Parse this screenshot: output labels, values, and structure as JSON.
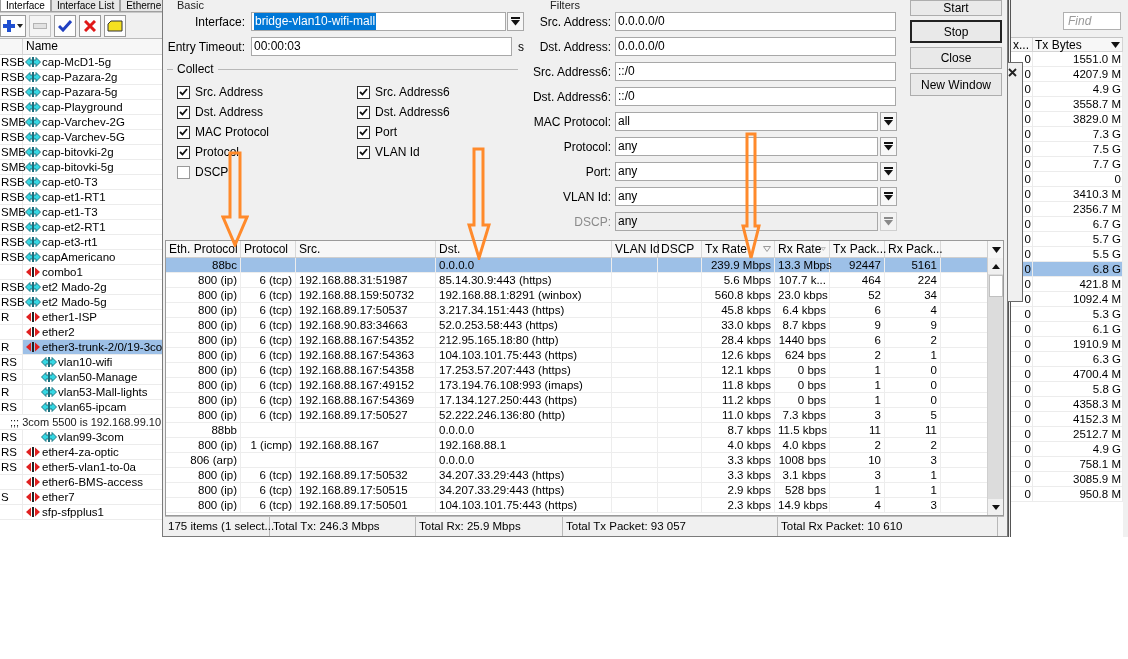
{
  "interfaces": {
    "tabs": [
      {
        "label": "Interface",
        "selected": true
      },
      {
        "label": "Interface List",
        "selected": false
      },
      {
        "label": "Etherne",
        "selected": false
      }
    ],
    "toolbar": [
      {
        "kind": "add",
        "disabled": false
      },
      {
        "kind": "remove",
        "disabled": true
      },
      {
        "kind": "enable",
        "disabled": false
      },
      {
        "kind": "disable",
        "disabled": false
      },
      {
        "kind": "comment",
        "disabled": false
      }
    ],
    "name_header": "Name",
    "rows": [
      {
        "flags": "RSB",
        "name": "cap-McD1-5g",
        "kind": "wireless",
        "selected": false
      },
      {
        "flags": "RSB",
        "name": "cap-Pazara-2g",
        "kind": "wireless",
        "selected": false
      },
      {
        "flags": "RSB",
        "name": "cap-Pazara-5g",
        "kind": "wireless",
        "selected": false
      },
      {
        "flags": "RSB",
        "name": "cap-Playground",
        "kind": "wireless",
        "selected": false
      },
      {
        "flags": "SMB",
        "name": "cap-Varchev-2G",
        "kind": "wireless",
        "selected": false
      },
      {
        "flags": "RSB",
        "name": "cap-Varchev-5G",
        "kind": "wireless",
        "selected": false
      },
      {
        "flags": "SMB",
        "name": "cap-bitovki-2g",
        "kind": "wireless",
        "selected": false
      },
      {
        "flags": "SMB",
        "name": "cap-bitovki-5g",
        "kind": "wireless",
        "selected": false
      },
      {
        "flags": "RSB",
        "name": "cap-et0-T3",
        "kind": "wireless",
        "selected": false
      },
      {
        "flags": "RSB",
        "name": "cap-et1-RT1",
        "kind": "wireless",
        "selected": false
      },
      {
        "flags": "SMB",
        "name": "cap-et1-T3",
        "kind": "wireless",
        "selected": false
      },
      {
        "flags": "RSB",
        "name": "cap-et2-RT1",
        "kind": "wireless",
        "selected": false
      },
      {
        "flags": "RSB",
        "name": "cap-et3-rt1",
        "kind": "wireless",
        "selected": false
      },
      {
        "flags": "RSB",
        "name": "capAmericano",
        "kind": "wireless",
        "selected": false
      },
      {
        "name": "combo1",
        "kind": "ethernet",
        "selected": false
      },
      {
        "flags": "RSB",
        "name": "et2 Mado-2g",
        "kind": "wireless",
        "selected": false
      },
      {
        "flags": "RSB",
        "name": "et2 Mado-5g",
        "kind": "wireless",
        "selected": false
      },
      {
        "flags": "R",
        "name": "ether1-ISP",
        "kind": "ethernet",
        "selected": false
      },
      {
        "name": "ether2",
        "kind": "ethernet",
        "selected": false
      },
      {
        "flags": "R",
        "name": "ether3-trunk-2/0/19-3co",
        "kind": "ethernet",
        "selected": true,
        "children": [
          {
            "flags": "RS",
            "name": "vlan10-wifi",
            "kind": "vlan",
            "selected": false
          },
          {
            "flags": "RS",
            "name": "vlan50-Manage",
            "kind": "vlan",
            "selected": false
          },
          {
            "flags": "R",
            "name": "vlan53-Mall-lights",
            "kind": "vlan",
            "selected": false
          },
          {
            "flags": "RS",
            "name": "vlan65-ipcam",
            "kind": "vlan",
            "selected": false
          },
          {
            "flags": "RS",
            "comment": ";;; 3com 5500 is 192.168.99.10",
            "name": "vlan99-3com",
            "kind": "vlan",
            "selected": false
          }
        ]
      },
      {
        "flags": "RS",
        "name": "ether4-za-optic",
        "kind": "ethernet",
        "selected": false
      },
      {
        "flags": "RS",
        "name": "ether5-vlan1-to-0a",
        "kind": "ethernet",
        "selected": false
      },
      {
        "name": "ether6-BMS-access",
        "kind": "ethernet",
        "selected": false
      },
      {
        "flags": "S",
        "name": "ether7",
        "kind": "ethernet",
        "selected": false
      },
      {
        "name": "sfp-sfpplus1",
        "kind": "ethernet",
        "selected": false
      }
    ]
  },
  "torch": {
    "basic": {
      "title": "Basic",
      "interface_label": "Interface:",
      "interface": "bridge-vlan10-wifi-mall",
      "interface_text_selected": true,
      "timeout_label": "Entry Timeout:",
      "entry_timeout": "00:00:03",
      "timeout_unit": "s"
    },
    "collect": {
      "title": "Collect",
      "options": [
        {
          "label": "Src. Address",
          "checked": true
        },
        {
          "label": "Dst. Address",
          "checked": true
        },
        {
          "label": "MAC Protocol",
          "checked": true
        },
        {
          "label": "Protocol",
          "checked": true
        },
        {
          "label": "DSCP",
          "checked": false
        },
        {
          "label": "Src. Address6",
          "checked": true
        },
        {
          "label": "Dst. Address6",
          "checked": true
        },
        {
          "label": "Port",
          "checked": true
        },
        {
          "label": "VLAN Id",
          "checked": true
        }
      ]
    },
    "filters": {
      "title": "Filters",
      "fields": [
        {
          "label": "Src. Address:",
          "value": "0.0.0.0/0",
          "kind": "text",
          "disabled": false
        },
        {
          "label": "Dst. Address:",
          "value": "0.0.0.0/0",
          "kind": "text",
          "disabled": false
        },
        {
          "label": "Src. Address6:",
          "value": "::/0",
          "kind": "text",
          "disabled": false
        },
        {
          "label": "Dst. Address6:",
          "value": "::/0",
          "kind": "text",
          "disabled": false
        },
        {
          "label": "MAC Protocol:",
          "value": "all",
          "kind": "select",
          "disabled": false
        },
        {
          "label": "Protocol:",
          "value": "any",
          "kind": "select",
          "disabled": false
        },
        {
          "label": "Port:",
          "value": "any",
          "kind": "select",
          "disabled": false
        },
        {
          "label": "VLAN Id:",
          "value": "any",
          "kind": "select",
          "disabled": false
        },
        {
          "label": "DSCP:",
          "value": "any",
          "kind": "select",
          "disabled": true
        }
      ]
    },
    "buttons": [
      {
        "label": "Start",
        "default": false
      },
      {
        "label": "Stop",
        "default": true
      },
      {
        "label": "Close",
        "default": false
      },
      {
        "label": "New Window",
        "default": false
      }
    ],
    "table": {
      "columns": [
        {
          "label": "Eth. Protocol"
        },
        {
          "label": "Protocol"
        },
        {
          "label": "Src."
        },
        {
          "label": "Dst."
        },
        {
          "label": "VLAN Id"
        },
        {
          "label": "DSCP"
        },
        {
          "label": "Tx Rate",
          "sort_indicator": true
        },
        {
          "label": "Rx Rate",
          "sort_indicator": true
        },
        {
          "label": "Tx Pack..."
        },
        {
          "label": "Rx Pack..."
        }
      ],
      "rows": [
        {
          "eth_protocol": "88bc",
          "dst": "0.0.0.0",
          "tx_rate": "239.9 Mbps",
          "rx_rate": "13.3 Mbps",
          "tx_packets": "92447",
          "rx_packets": "5161",
          "selected": true
        },
        {
          "eth_protocol": "800 (ip)",
          "protocol": "6 (tcp)",
          "src": "192.168.88.31:51987",
          "dst": "85.14.30.9:443 (https)",
          "tx_rate": "5.6 Mbps",
          "rx_rate": "107.7 k...",
          "tx_packets": "464",
          "rx_packets": "224",
          "selected": false
        },
        {
          "eth_protocol": "800 (ip)",
          "protocol": "6 (tcp)",
          "src": "192.168.88.159:50732",
          "dst": "192.168.88.1:8291 (winbox)",
          "tx_rate": "560.8 kbps",
          "rx_rate": "23.0 kbps",
          "tx_packets": "52",
          "rx_packets": "34",
          "selected": false
        },
        {
          "eth_protocol": "800 (ip)",
          "protocol": "6 (tcp)",
          "src": "192.168.89.17:50537",
          "dst": "3.217.34.151:443 (https)",
          "tx_rate": "45.8 kbps",
          "rx_rate": "6.4 kbps",
          "tx_packets": "6",
          "rx_packets": "4",
          "selected": false
        },
        {
          "eth_protocol": "800 (ip)",
          "protocol": "6 (tcp)",
          "src": "192.168.90.83:34663",
          "dst": "52.0.253.58:443 (https)",
          "tx_rate": "33.0 kbps",
          "rx_rate": "8.7 kbps",
          "tx_packets": "9",
          "rx_packets": "9",
          "selected": false
        },
        {
          "eth_protocol": "800 (ip)",
          "protocol": "6 (tcp)",
          "src": "192.168.88.167:54352",
          "dst": "212.95.165.18:80 (http)",
          "tx_rate": "28.4 kbps",
          "rx_rate": "1440 bps",
          "tx_packets": "6",
          "rx_packets": "2",
          "selected": false
        },
        {
          "eth_protocol": "800 (ip)",
          "protocol": "6 (tcp)",
          "src": "192.168.88.167:54363",
          "dst": "104.103.101.75:443 (https)",
          "tx_rate": "12.6 kbps",
          "rx_rate": "624 bps",
          "tx_packets": "2",
          "rx_packets": "1",
          "selected": false
        },
        {
          "eth_protocol": "800 (ip)",
          "protocol": "6 (tcp)",
          "src": "192.168.88.167:54358",
          "dst": "17.253.57.207:443 (https)",
          "tx_rate": "12.1 kbps",
          "rx_rate": "0 bps",
          "tx_packets": "1",
          "rx_packets": "0",
          "selected": false
        },
        {
          "eth_protocol": "800 (ip)",
          "protocol": "6 (tcp)",
          "src": "192.168.88.167:49152",
          "dst": "173.194.76.108:993 (imaps)",
          "tx_rate": "11.8 kbps",
          "rx_rate": "0 bps",
          "tx_packets": "1",
          "rx_packets": "0",
          "selected": false
        },
        {
          "eth_protocol": "800 (ip)",
          "protocol": "6 (tcp)",
          "src": "192.168.88.167:54369",
          "dst": "17.134.127.250:443 (https)",
          "tx_rate": "11.2 kbps",
          "rx_rate": "0 bps",
          "tx_packets": "1",
          "rx_packets": "0",
          "selected": false
        },
        {
          "eth_protocol": "800 (ip)",
          "protocol": "6 (tcp)",
          "src": "192.168.89.17:50527",
          "dst": "52.222.246.136:80 (http)",
          "tx_rate": "11.0 kbps",
          "rx_rate": "7.3 kbps",
          "tx_packets": "3",
          "rx_packets": "5",
          "selected": false
        },
        {
          "eth_protocol": "88bb",
          "dst": "0.0.0.0",
          "tx_rate": "8.7 kbps",
          "rx_rate": "11.5 kbps",
          "tx_packets": "11",
          "rx_packets": "11",
          "selected": false
        },
        {
          "eth_protocol": "800 (ip)",
          "protocol": "1 (icmp)",
          "src": "192.168.88.167",
          "dst": "192.168.88.1",
          "tx_rate": "4.0 kbps",
          "rx_rate": "4.0 kbps",
          "tx_packets": "2",
          "rx_packets": "2",
          "selected": false
        },
        {
          "eth_protocol": "806 (arp)",
          "dst": "0.0.0.0",
          "tx_rate": "3.3 kbps",
          "rx_rate": "1008 bps",
          "tx_packets": "10",
          "rx_packets": "3",
          "selected": false
        },
        {
          "eth_protocol": "800 (ip)",
          "protocol": "6 (tcp)",
          "src": "192.168.89.17:50532",
          "dst": "34.207.33.29:443 (https)",
          "tx_rate": "3.3 kbps",
          "rx_rate": "3.1 kbps",
          "tx_packets": "3",
          "rx_packets": "1",
          "selected": false
        },
        {
          "eth_protocol": "800 (ip)",
          "protocol": "6 (tcp)",
          "src": "192.168.89.17:50515",
          "dst": "34.207.33.29:443 (https)",
          "tx_rate": "2.9 kbps",
          "rx_rate": "528 bps",
          "tx_packets": "1",
          "rx_packets": "1",
          "selected": false
        },
        {
          "eth_protocol": "800 (ip)",
          "protocol": "6 (tcp)",
          "src": "192.168.89.17:50501",
          "dst": "104.103.101.75:443 (https)",
          "tx_rate": "2.3 kbps",
          "rx_rate": "14.9 kbps",
          "tx_packets": "4",
          "rx_packets": "3",
          "selected": false
        }
      ]
    },
    "status_bar": [
      "175 items (1 select...",
      "Total Tx: 246.3 Mbps",
      "Total Rx: 25.9 Mbps",
      "Total Tx Packet: 93 057",
      "Total Rx Packet: 10 610"
    ]
  },
  "traffic_list": {
    "find": {
      "placeholder": "Find"
    },
    "columns": [
      "x...",
      "Tx Bytes"
    ],
    "rows": [
      {
        "rx": "0",
        "tx_bytes": "1551.0 M",
        "selected": false
      },
      {
        "rx": "0",
        "tx_bytes": "4207.9 M",
        "selected": false
      },
      {
        "rx": "0",
        "tx_bytes": "4.9 G",
        "selected": false
      },
      {
        "rx": "0",
        "tx_bytes": "3558.7 M",
        "selected": false
      },
      {
        "rx": "0",
        "tx_bytes": "3829.0 M",
        "selected": false
      },
      {
        "rx": "0",
        "tx_bytes": "7.3 G",
        "selected": false
      },
      {
        "rx": "0",
        "tx_bytes": "7.5 G",
        "selected": false
      },
      {
        "rx": "0",
        "tx_bytes": "7.7 G",
        "selected": false
      },
      {
        "rx": "0",
        "tx_bytes": "0",
        "selected": false
      },
      {
        "rx": "0",
        "tx_bytes": "3410.3 M",
        "selected": false
      },
      {
        "rx": "0",
        "tx_bytes": "2356.7 M",
        "selected": false
      },
      {
        "rx": "0",
        "tx_bytes": "6.7 G",
        "selected": false
      },
      {
        "rx": "0",
        "tx_bytes": "5.7 G",
        "selected": false
      },
      {
        "rx": "0",
        "tx_bytes": "5.5 G",
        "selected": false
      },
      {
        "rx": "0",
        "tx_bytes": "6.8 G",
        "selected": true
      },
      {
        "rx": "0",
        "tx_bytes": "421.8 M",
        "selected": false
      },
      {
        "rx": "0",
        "tx_bytes": "1092.4 M",
        "selected": false
      },
      {
        "rx": "0",
        "tx_bytes": "5.3 G",
        "selected": false
      },
      {
        "rx": "0",
        "tx_bytes": "6.1 G",
        "selected": false
      },
      {
        "rx": "0",
        "tx_bytes": "1910.9 M",
        "selected": false
      },
      {
        "rx": "0",
        "tx_bytes": "6.3 G",
        "selected": false
      },
      {
        "rx": "0",
        "tx_bytes": "4700.4 M",
        "selected": false
      },
      {
        "rx": "0",
        "tx_bytes": "5.8 G",
        "selected": false
      },
      {
        "rx": "0",
        "tx_bytes": "4358.3 M",
        "selected": false
      },
      {
        "rx": "0",
        "tx_bytes": "4152.3 M",
        "selected": false
      },
      {
        "rx": "0",
        "tx_bytes": "2512.7 M",
        "selected": false
      },
      {
        "rx": "0",
        "tx_bytes": "4.9 G",
        "selected": false
      },
      {
        "rx": "0",
        "tx_bytes": "758.1 M",
        "selected": false
      },
      {
        "rx": "0",
        "tx_bytes": "3085.9 M",
        "selected": false
      },
      {
        "rx": "0",
        "tx_bytes": "950.8 M",
        "selected": false
      }
    ]
  }
}
